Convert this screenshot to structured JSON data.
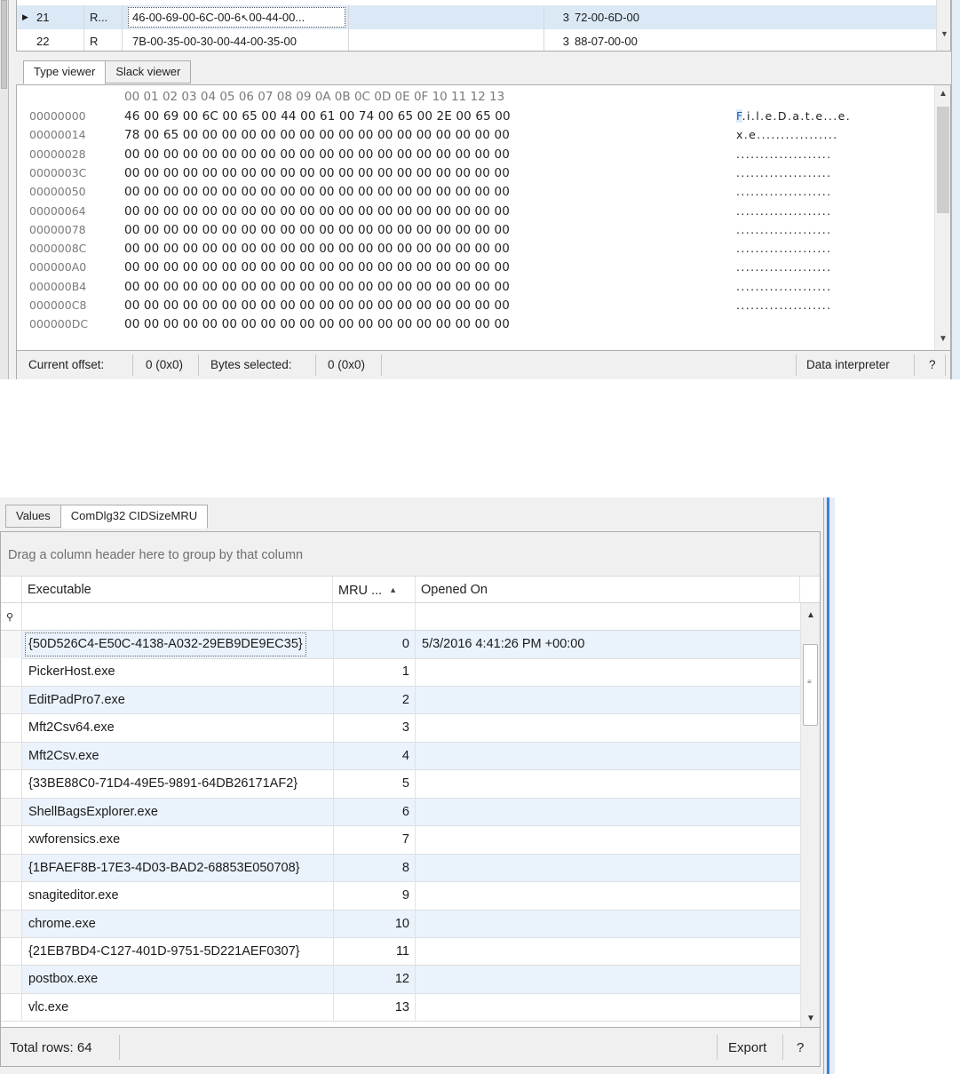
{
  "top_grid": {
    "rows": [
      {
        "id": "21",
        "col_b": "R...",
        "value": "46-00-69-00-6C-00-6",
        "value_tail": "00-44-00...",
        "count": "3",
        "hex": "72-00-6D-00",
        "selected": true
      },
      {
        "id": "22",
        "col_b": "R",
        "value": "7B-00-35-00-30-00-44-00-35-00",
        "value_tail": "",
        "count": "3",
        "hex": "88-07-00-00",
        "selected": false
      }
    ]
  },
  "viewer_tabs": [
    {
      "label": "Type viewer",
      "active": true
    },
    {
      "label": "Slack viewer",
      "active": false
    }
  ],
  "hex_view": {
    "column_header": "00 01 02 03 04 05 06 07 08 09 0A 0B 0C 0D 0E 0F 10 11 12 13",
    "lines": [
      {
        "offset": "00000000",
        "bytes": "46 00 69 00 6C 00 65 00 44 00 61 00 74 00 65 00 2E 00 65 00",
        "ascii_hl": "F",
        "ascii": ".i.l.e.D.a.t.e...e."
      },
      {
        "offset": "00000014",
        "bytes": "78 00 65 00 00 00 00 00 00 00 00 00 00 00 00 00 00 00 00 00",
        "ascii_hl": "",
        "ascii": "x.e................."
      },
      {
        "offset": "00000028",
        "bytes": "00 00 00 00 00 00 00 00 00 00 00 00 00 00 00 00 00 00 00 00",
        "ascii_hl": "",
        "ascii": "...................."
      },
      {
        "offset": "0000003C",
        "bytes": "00 00 00 00 00 00 00 00 00 00 00 00 00 00 00 00 00 00 00 00",
        "ascii_hl": "",
        "ascii": "...................."
      },
      {
        "offset": "00000050",
        "bytes": "00 00 00 00 00 00 00 00 00 00 00 00 00 00 00 00 00 00 00 00",
        "ascii_hl": "",
        "ascii": "...................."
      },
      {
        "offset": "00000064",
        "bytes": "00 00 00 00 00 00 00 00 00 00 00 00 00 00 00 00 00 00 00 00",
        "ascii_hl": "",
        "ascii": "...................."
      },
      {
        "offset": "00000078",
        "bytes": "00 00 00 00 00 00 00 00 00 00 00 00 00 00 00 00 00 00 00 00",
        "ascii_hl": "",
        "ascii": "...................."
      },
      {
        "offset": "0000008C",
        "bytes": "00 00 00 00 00 00 00 00 00 00 00 00 00 00 00 00 00 00 00 00",
        "ascii_hl": "",
        "ascii": "...................."
      },
      {
        "offset": "000000A0",
        "bytes": "00 00 00 00 00 00 00 00 00 00 00 00 00 00 00 00 00 00 00 00",
        "ascii_hl": "",
        "ascii": "...................."
      },
      {
        "offset": "000000B4",
        "bytes": "00 00 00 00 00 00 00 00 00 00 00 00 00 00 00 00 00 00 00 00",
        "ascii_hl": "",
        "ascii": "...................."
      },
      {
        "offset": "000000C8",
        "bytes": "00 00 00 00 00 00 00 00 00 00 00 00 00 00 00 00 00 00 00 00",
        "ascii_hl": "",
        "ascii": "...................."
      },
      {
        "offset": "000000DC",
        "bytes": "00 00 00 00 00 00 00 00 00 00 00 00 00 00 00 00 00 00 00 00",
        "ascii_hl": "",
        "ascii": ""
      }
    ]
  },
  "top_status": {
    "current_offset_label": "Current offset:",
    "current_offset_value": "0 (0x0)",
    "bytes_selected_label": "Bytes selected:",
    "bytes_selected_value": "0 (0x0)",
    "data_interpreter_label": "Data interpreter",
    "help_label": "?"
  },
  "bottom_tabs": [
    {
      "label": "Values",
      "active": false
    },
    {
      "label": "ComDlg32 CIDSizeMRU",
      "active": true
    }
  ],
  "group_panel": {
    "text": "Drag a column header here to group by that column"
  },
  "columns": {
    "executable": "Executable",
    "mru": "MRU ...",
    "sort_indicator": "▲",
    "opened_on": "Opened On"
  },
  "rows": [
    {
      "executable": "{50D526C4-E50C-4138-A032-29EB9DE9EC35}",
      "mru": "0",
      "opened": "5/3/2016 4:41:26 PM +00:00"
    },
    {
      "executable": "PickerHost.exe",
      "mru": "1",
      "opened": ""
    },
    {
      "executable": "EditPadPro7.exe",
      "mru": "2",
      "opened": ""
    },
    {
      "executable": "Mft2Csv64.exe",
      "mru": "3",
      "opened": ""
    },
    {
      "executable": "Mft2Csv.exe",
      "mru": "4",
      "opened": ""
    },
    {
      "executable": "{33BE88C0-71D4-49E5-9891-64DB26171AF2}",
      "mru": "5",
      "opened": ""
    },
    {
      "executable": "ShellBagsExplorer.exe",
      "mru": "6",
      "opened": ""
    },
    {
      "executable": "xwforensics.exe",
      "mru": "7",
      "opened": ""
    },
    {
      "executable": "{1BFAEF8B-17E3-4D03-BAD2-68853E050708}",
      "mru": "8",
      "opened": ""
    },
    {
      "executable": "snagiteditor.exe",
      "mru": "9",
      "opened": ""
    },
    {
      "executable": "chrome.exe",
      "mru": "10",
      "opened": ""
    },
    {
      "executable": "{21EB7BD4-C127-401D-9751-5D221AEF0307}",
      "mru": "11",
      "opened": ""
    },
    {
      "executable": "postbox.exe",
      "mru": "12",
      "opened": ""
    },
    {
      "executable": "vlc.exe",
      "mru": "13",
      "opened": ""
    }
  ],
  "bottom_status": {
    "total_rows": "Total rows: 64",
    "export_label": "Export",
    "help_label": "?"
  },
  "colors": {
    "selection": "#dbe9f7",
    "alt_row": "#eaf2fb",
    "window_accent": "#3b82d6",
    "chrome": "#f0f0f0"
  }
}
